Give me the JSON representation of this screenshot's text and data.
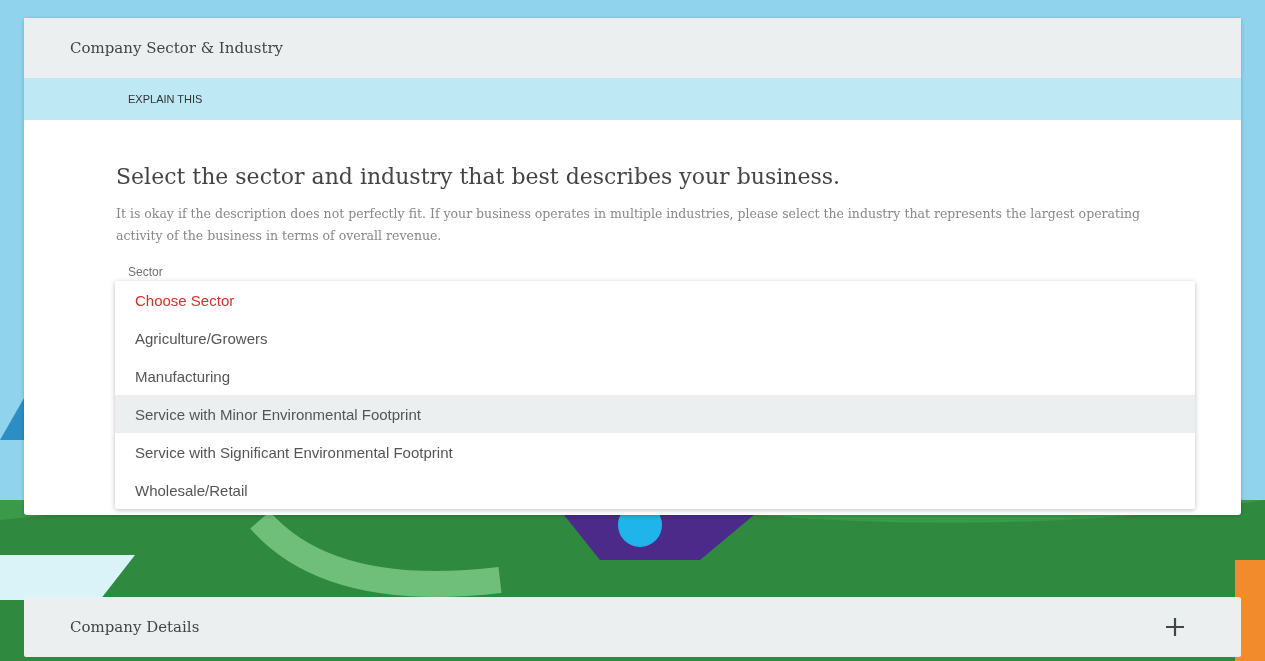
{
  "panel": {
    "title": "Company Sector & Industry",
    "explain_link": "EXPLAIN THIS"
  },
  "question": {
    "heading": "Select the sector and industry that best describes your business.",
    "description": "It is okay if the description does not perfectly fit. If your business operates in multiple industries, please select the industry that represents the largest operating activity of the business in terms of overall revenue."
  },
  "sector_field": {
    "label": "Sector",
    "options": [
      {
        "label": "Choose Sector",
        "kind": "placeholder",
        "selected": false
      },
      {
        "label": "Agriculture/Growers",
        "kind": "option",
        "selected": false
      },
      {
        "label": "Manufacturing",
        "kind": "option",
        "selected": false
      },
      {
        "label": "Service with Minor Environmental Footprint",
        "kind": "option",
        "selected": true
      },
      {
        "label": "Service with Significant Environmental Footprint",
        "kind": "option",
        "selected": false
      },
      {
        "label": "Wholesale/Retail",
        "kind": "option",
        "selected": false
      }
    ]
  },
  "next_panel": {
    "title": "Company Details",
    "expanded": false
  }
}
